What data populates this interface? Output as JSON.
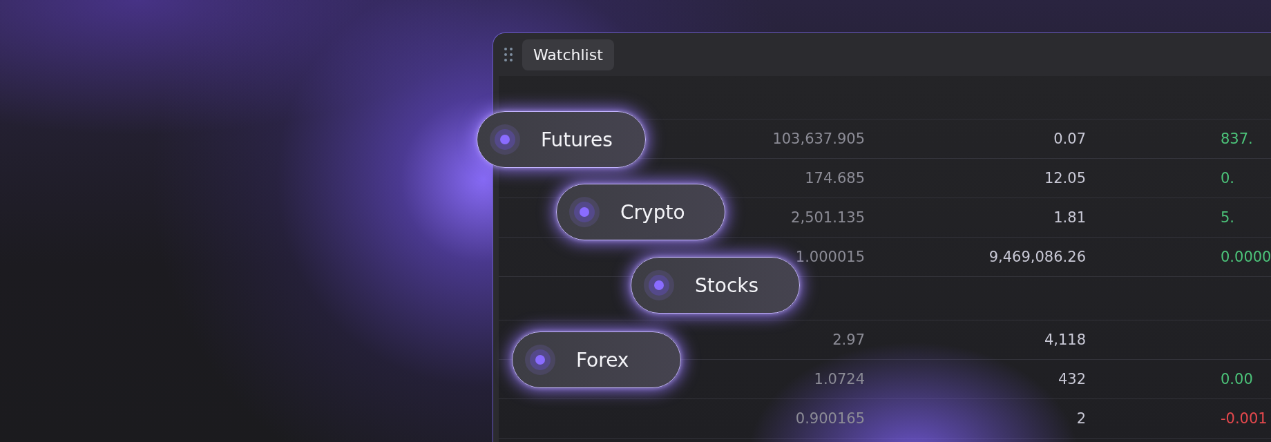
{
  "window": {
    "tab": "Watchlist"
  },
  "rows": [
    {
      "kind": "item",
      "column_1": "103,637.905",
      "column_2": "0.07",
      "column_3": "837.",
      "color": "#4cc47a"
    },
    {
      "kind": "item",
      "column_1": "174.685",
      "column_2": "12.05",
      "column_3": "0.",
      "color": "#4cc47a"
    },
    {
      "kind": "item",
      "column_1": "2,501.135",
      "column_2": "1.81",
      "column_3": "5.",
      "color": "#4cc47a"
    },
    {
      "kind": "item",
      "column_1": "1.000015",
      "column_2": "9,469,086.26",
      "column_3": "0.0000",
      "color": "#4cc47a"
    },
    {
      "kind": "group"
    },
    {
      "kind": "item",
      "column_1": "2.97",
      "column_2": "4,118"
    },
    {
      "kind": "item",
      "column_1": "1.0724",
      "column_2": "432",
      "column_3": "0.00",
      "color": "#4cc47a"
    },
    {
      "kind": "item",
      "column_1": "0.900165",
      "column_2": "2",
      "column_3": "-0.001",
      "color": "#e5484d"
    }
  ],
  "categories": [
    {
      "label": "Futures"
    },
    {
      "label": "Crypto"
    },
    {
      "label": "Stocks"
    },
    {
      "label": "Forex"
    }
  ]
}
